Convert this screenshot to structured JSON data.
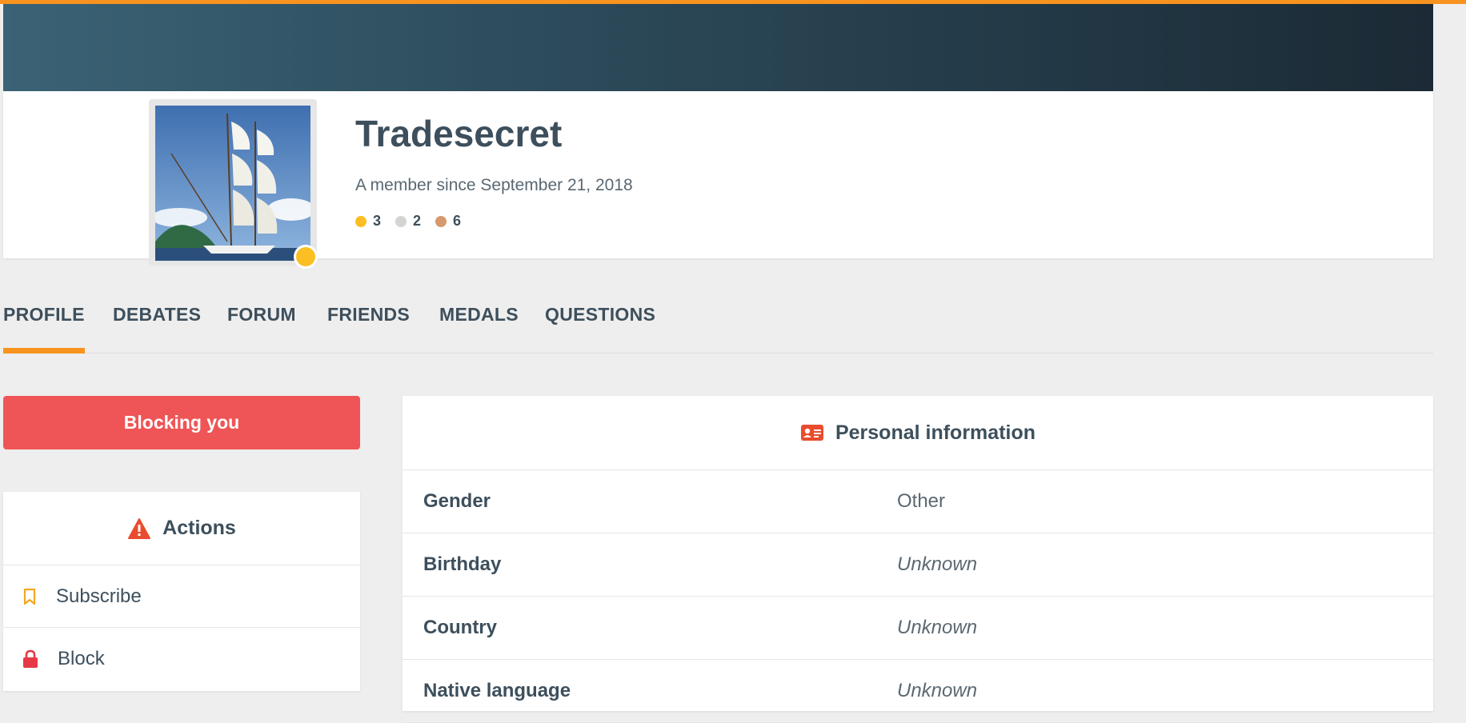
{
  "profile": {
    "username": "Tradesecret",
    "member_since": "A member since September 21, 2018",
    "status_color": "#fbbf24",
    "medals": [
      {
        "name": "gold",
        "count": "3",
        "color": "#fbbf24"
      },
      {
        "name": "silver",
        "count": "2",
        "color": "#d4d4d4"
      },
      {
        "name": "bronze",
        "count": "6",
        "color": "#d69a6e"
      }
    ]
  },
  "tabs": [
    {
      "label": "PROFILE",
      "active": true
    },
    {
      "label": "DEBATES"
    },
    {
      "label": "FORUM"
    },
    {
      "label": "FRIENDS"
    },
    {
      "label": "MEDALS"
    },
    {
      "label": "QUESTIONS"
    }
  ],
  "blocking_label": "Blocking you",
  "actions": {
    "title": "Actions",
    "icon": "warning-icon",
    "items": [
      {
        "label": "Subscribe",
        "icon": "bookmark-icon"
      },
      {
        "label": "Block",
        "icon": "lock-icon"
      }
    ]
  },
  "personal_info": {
    "title": "Personal information",
    "icon": "id-card-icon",
    "rows": [
      {
        "label": "Gender",
        "value": "Other"
      },
      {
        "label": "Birthday",
        "value": "Unknown"
      },
      {
        "label": "Country",
        "value": "Unknown"
      },
      {
        "label": "Native language",
        "value": "Unknown"
      }
    ]
  },
  "colors": {
    "accent": "#f7931e",
    "danger": "#ef5556",
    "text": "#3d4f5c"
  }
}
